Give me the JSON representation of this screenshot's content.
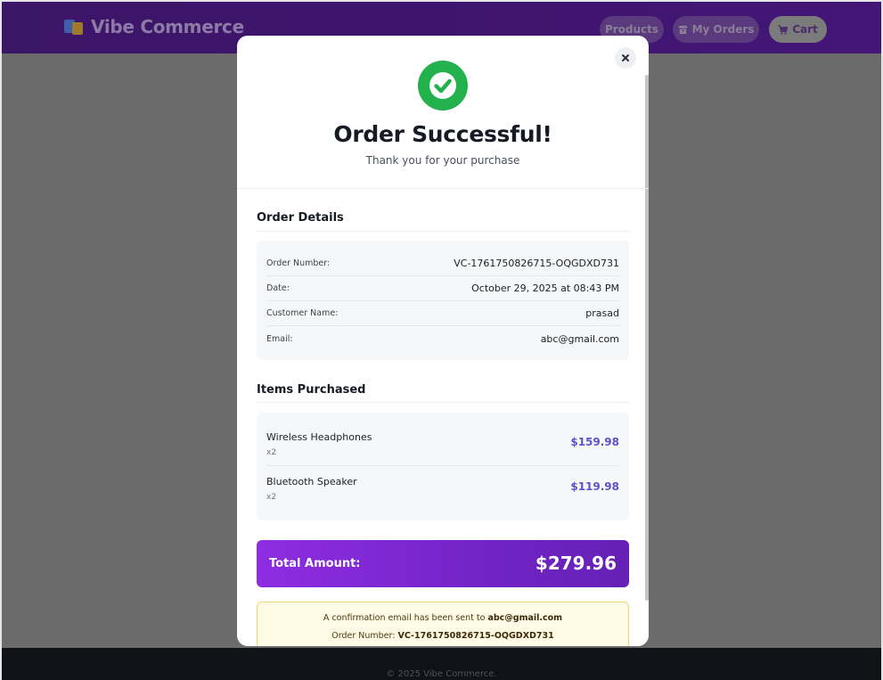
{
  "navbar": {
    "brand": "Vibe Commerce",
    "products_label": "Products",
    "orders_label": "My Orders",
    "cart_label": "Cart"
  },
  "modal": {
    "title": "Order Successful!",
    "subtitle": "Thank you for your purchase",
    "order_details": {
      "heading": "Order Details",
      "rows": [
        {
          "label": "Order Number:",
          "value": "VC-1761750826715-OQGDXD731"
        },
        {
          "label": "Date:",
          "value": "October 29, 2025 at 08:43 PM"
        },
        {
          "label": "Customer Name:",
          "value": "prasad"
        },
        {
          "label": "Email:",
          "value": "abc@gmail.com"
        }
      ]
    },
    "items": {
      "heading": "Items Purchased",
      "list": [
        {
          "name": "Wireless Headphones",
          "qty": "x2",
          "price": "$159.98"
        },
        {
          "name": "Bluetooth Speaker",
          "qty": "x2",
          "price": "$119.98"
        }
      ]
    },
    "total": {
      "label": "Total Amount:",
      "value": "$279.96"
    },
    "notice": {
      "email_text": "A confirmation email has been sent to",
      "email": "abc@gmail.com",
      "order_text": "Order Number:",
      "order_number": "VC-1761750826715-OQGDXD731"
    }
  },
  "footer": {
    "text": "© 2025 Vibe Commerce."
  },
  "colors": {
    "accent": "#5b53c9",
    "success": "#22b14c",
    "total_gradient_start": "#8e2de2",
    "total_gradient_end": "#6520b5"
  }
}
